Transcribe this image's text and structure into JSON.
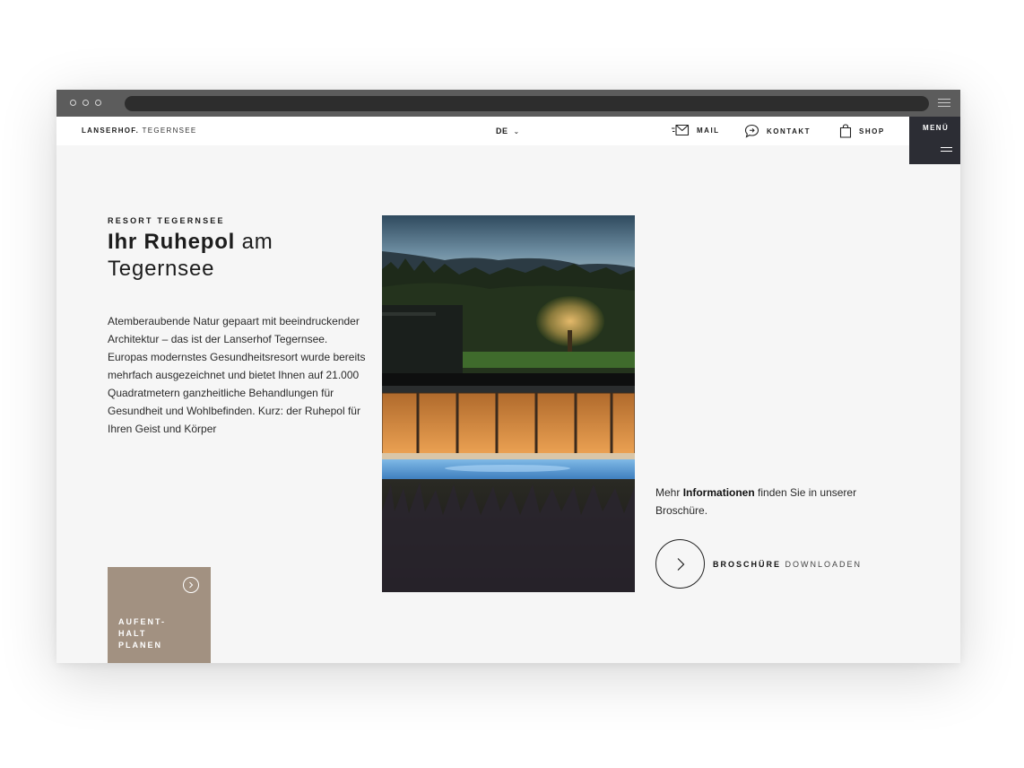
{
  "nav": {
    "brand": "LANSERHOF.",
    "brand_location": "TEGERNSEE",
    "language": "DE",
    "mail_label": "MAIL",
    "contact_label": "KONTAKT",
    "shop_label": "SHOP",
    "menu_label": "MENÜ"
  },
  "hero": {
    "eyebrow": "RESORT TEGERNSEE",
    "title_strong": "Ihr Ruhepol",
    "title_light": " am Tegernsee",
    "intro": "Atemberaubende Natur gepaart mit beeindruckender Architektur – das ist der Lanserhof Tegernsee. Europas modernstes Gesundheitsresort wurde bereits mehrfach ausgezeichnet und bietet Ihnen auf 21.000 Quadratmetern ganzheitliche Behandlungen für Gesundheit und Wohlbefinden. Kurz: der Ruhepol für Ihren Geist und Körper"
  },
  "brochure": {
    "text_before": "Mehr ",
    "text_bold": "Informationen",
    "text_after": " finden Sie in unserer Broschüre.",
    "button_strong": "BROSCHÜRE",
    "button_light": "DOWNLOADEN"
  },
  "plan_card": {
    "label": "AUFENT-\nHALT\nPLANEN"
  },
  "colors": {
    "menu_bg": "#2c2d34",
    "plan_card_bg": "#a29181",
    "page_bg": "#f6f6f6",
    "browser_chrome": "#5c5c5c"
  },
  "icons": [
    "mail-icon",
    "chat-icon",
    "shopping-bag-icon",
    "chevron-down-icon",
    "chevron-right-icon",
    "hamburger-icon"
  ]
}
